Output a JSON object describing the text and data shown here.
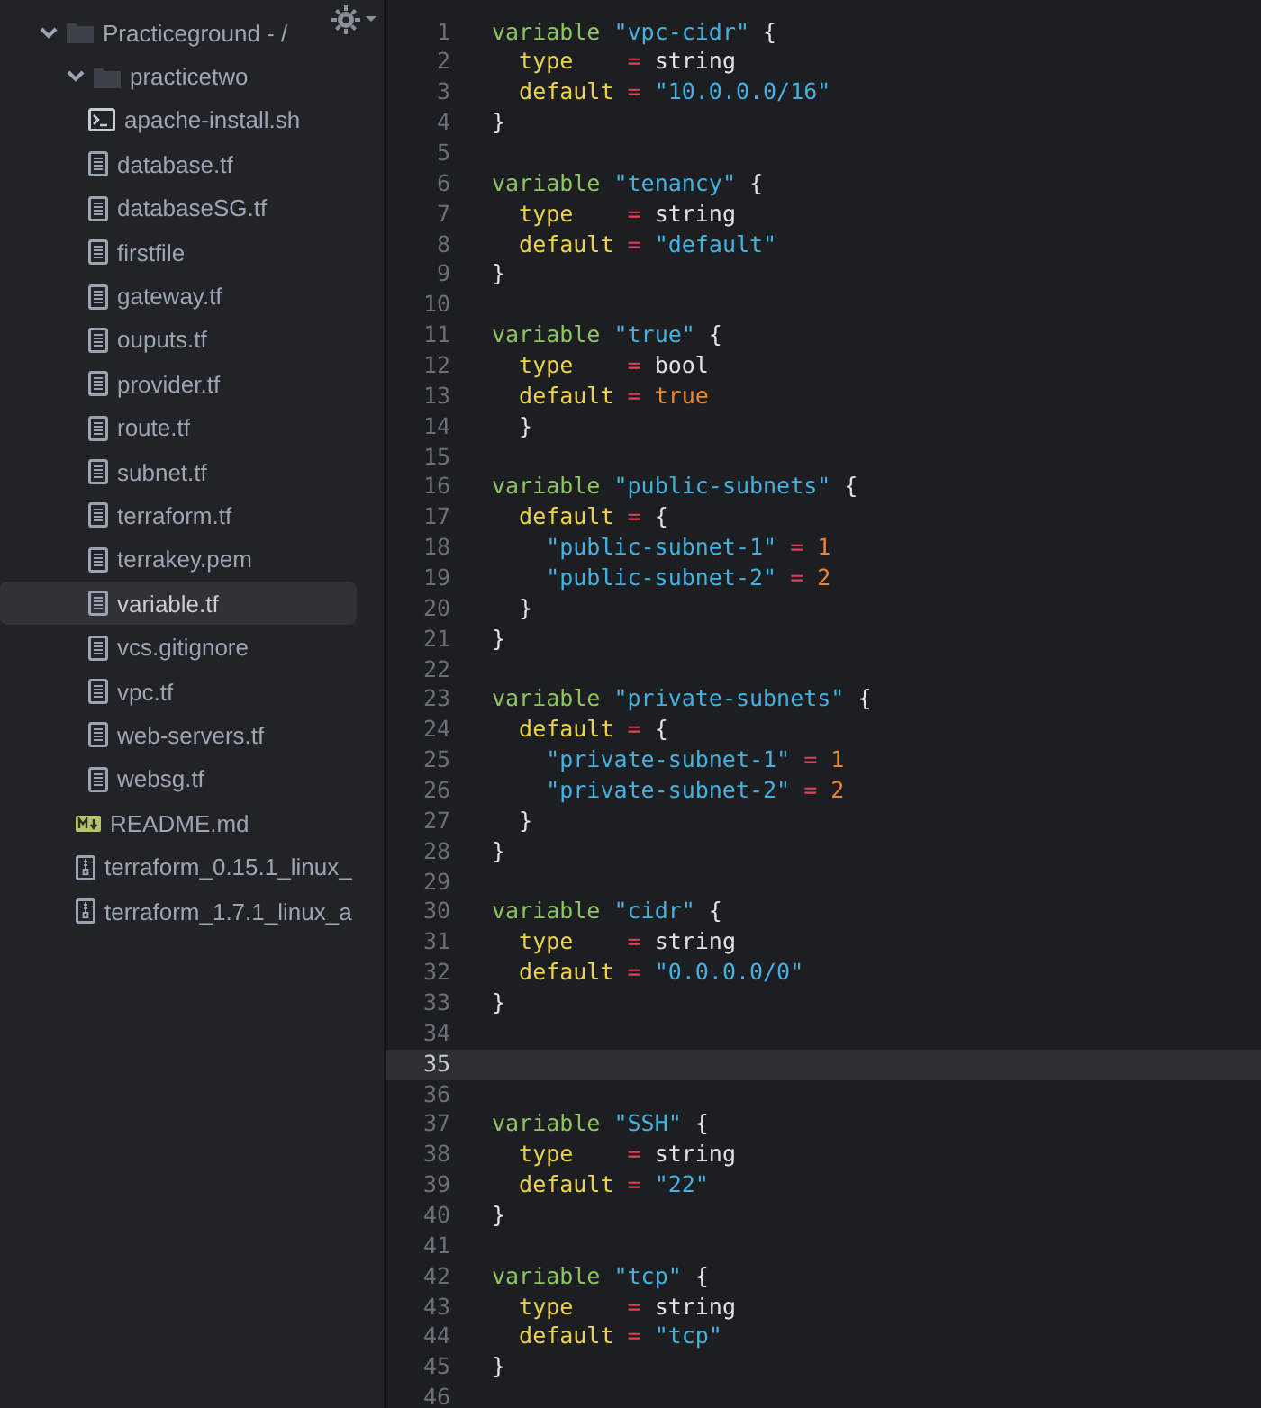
{
  "sidebar": {
    "tree": [
      {
        "label": "Practiceground - /",
        "kind": "folder",
        "expanded": true,
        "selected": false,
        "children": [
          {
            "label": "practicetwo",
            "kind": "folder",
            "expanded": true,
            "selected": false,
            "children": [
              {
                "label": "apache-install.sh",
                "kind": "terminal",
                "selected": false
              },
              {
                "label": "database.tf",
                "kind": "file",
                "selected": false
              },
              {
                "label": "databaseSG.tf",
                "kind": "file",
                "selected": false
              },
              {
                "label": "firstfile",
                "kind": "file",
                "selected": false
              },
              {
                "label": "gateway.tf",
                "kind": "file",
                "selected": false
              },
              {
                "label": "ouputs.tf",
                "kind": "file",
                "selected": false
              },
              {
                "label": "provider.tf",
                "kind": "file",
                "selected": false
              },
              {
                "label": "route.tf",
                "kind": "file",
                "selected": false
              },
              {
                "label": "subnet.tf",
                "kind": "file",
                "selected": false
              },
              {
                "label": "terraform.tf",
                "kind": "file",
                "selected": false
              },
              {
                "label": "terrakey.pem",
                "kind": "file",
                "selected": false
              },
              {
                "label": "variable.tf",
                "kind": "file",
                "selected": true
              },
              {
                "label": "vcs.gitignore",
                "kind": "file",
                "selected": false
              },
              {
                "label": "vpc.tf",
                "kind": "file",
                "selected": false
              },
              {
                "label": "web-servers.tf",
                "kind": "file",
                "selected": false
              },
              {
                "label": "websg.tf",
                "kind": "file",
                "selected": false
              }
            ]
          },
          {
            "label": "README.md",
            "kind": "markdown",
            "selected": false
          },
          {
            "label": "terraform_0.15.1_linux_",
            "kind": "archive",
            "selected": false
          },
          {
            "label": "terraform_1.7.1_linux_a",
            "kind": "archive",
            "selected": false
          }
        ]
      }
    ]
  },
  "editor": {
    "lines": [
      {
        "number": "1",
        "current": false,
        "tokens": [
          {
            "kind": "keyword",
            "text": "variable"
          },
          {
            "kind": "string",
            "text": " \"vpc-cidr\""
          },
          {
            "kind": "plain",
            "text": " {"
          }
        ]
      },
      {
        "number": "2",
        "current": false,
        "tokens": [
          {
            "kind": "property",
            "text": "  type"
          },
          {
            "kind": "operator",
            "text": "    ="
          },
          {
            "kind": "plain",
            "text": " string"
          }
        ]
      },
      {
        "number": "3",
        "current": false,
        "tokens": [
          {
            "kind": "property",
            "text": "  default"
          },
          {
            "kind": "operator",
            "text": " ="
          },
          {
            "kind": "string",
            "text": " \"10.0.0.0/16\""
          }
        ]
      },
      {
        "number": "4",
        "current": false,
        "tokens": [
          {
            "kind": "plain",
            "text": "}"
          }
        ]
      },
      {
        "number": "5",
        "current": false
      },
      {
        "number": "6",
        "current": false,
        "tokens": [
          {
            "kind": "keyword",
            "text": "variable"
          },
          {
            "kind": "string",
            "text": " \"tenancy\""
          },
          {
            "kind": "plain",
            "text": " {"
          }
        ]
      },
      {
        "number": "7",
        "current": false,
        "tokens": [
          {
            "kind": "property",
            "text": "  type"
          },
          {
            "kind": "operator",
            "text": "    ="
          },
          {
            "kind": "plain",
            "text": " string"
          }
        ]
      },
      {
        "number": "8",
        "current": false,
        "tokens": [
          {
            "kind": "property",
            "text": "  default"
          },
          {
            "kind": "operator",
            "text": " ="
          },
          {
            "kind": "string",
            "text": " \"default\""
          }
        ]
      },
      {
        "number": "9",
        "current": false,
        "tokens": [
          {
            "kind": "plain",
            "text": "}"
          }
        ]
      },
      {
        "number": "10",
        "current": false
      },
      {
        "number": "11",
        "current": false,
        "tokens": [
          {
            "kind": "keyword",
            "text": "variable"
          },
          {
            "kind": "string",
            "text": " \"true\""
          },
          {
            "kind": "plain",
            "text": " {"
          }
        ]
      },
      {
        "number": "12",
        "current": false,
        "tokens": [
          {
            "kind": "property",
            "text": "  type"
          },
          {
            "kind": "operator",
            "text": "    ="
          },
          {
            "kind": "plain",
            "text": " bool"
          }
        ]
      },
      {
        "number": "13",
        "current": false,
        "tokens": [
          {
            "kind": "property",
            "text": "  default"
          },
          {
            "kind": "operator",
            "text": " ="
          },
          {
            "kind": "number",
            "text": " true"
          }
        ]
      },
      {
        "number": "14",
        "current": false,
        "tokens": [
          {
            "kind": "plain",
            "text": "  }"
          }
        ]
      },
      {
        "number": "15",
        "current": false
      },
      {
        "number": "16",
        "current": false,
        "tokens": [
          {
            "kind": "keyword",
            "text": "variable"
          },
          {
            "kind": "string",
            "text": " \"public-subnets\""
          },
          {
            "kind": "plain",
            "text": " {"
          }
        ]
      },
      {
        "number": "17",
        "current": false,
        "tokens": [
          {
            "kind": "property",
            "text": "  default"
          },
          {
            "kind": "operator",
            "text": " ="
          },
          {
            "kind": "plain",
            "text": " {"
          }
        ]
      },
      {
        "number": "18",
        "current": false,
        "tokens": [
          {
            "kind": "string",
            "text": "    \"public-subnet-1\""
          },
          {
            "kind": "operator",
            "text": " ="
          },
          {
            "kind": "number",
            "text": " 1"
          }
        ]
      },
      {
        "number": "19",
        "current": false,
        "tokens": [
          {
            "kind": "string",
            "text": "    \"public-subnet-2\""
          },
          {
            "kind": "operator",
            "text": " ="
          },
          {
            "kind": "number",
            "text": " 2"
          }
        ]
      },
      {
        "number": "20",
        "current": false,
        "tokens": [
          {
            "kind": "plain",
            "text": "  }"
          }
        ]
      },
      {
        "number": "21",
        "current": false,
        "tokens": [
          {
            "kind": "plain",
            "text": "}"
          }
        ]
      },
      {
        "number": "22",
        "current": false
      },
      {
        "number": "23",
        "current": false,
        "tokens": [
          {
            "kind": "keyword",
            "text": "variable"
          },
          {
            "kind": "string",
            "text": " \"private-subnets\""
          },
          {
            "kind": "plain",
            "text": " {"
          }
        ]
      },
      {
        "number": "24",
        "current": false,
        "tokens": [
          {
            "kind": "property",
            "text": "  default"
          },
          {
            "kind": "operator",
            "text": " ="
          },
          {
            "kind": "plain",
            "text": " {"
          }
        ]
      },
      {
        "number": "25",
        "current": false,
        "tokens": [
          {
            "kind": "string",
            "text": "    \"private-subnet-1\""
          },
          {
            "kind": "operator",
            "text": " ="
          },
          {
            "kind": "number",
            "text": " 1"
          }
        ]
      },
      {
        "number": "26",
        "current": false,
        "tokens": [
          {
            "kind": "string",
            "text": "    \"private-subnet-2\""
          },
          {
            "kind": "operator",
            "text": " ="
          },
          {
            "kind": "number",
            "text": " 2"
          }
        ]
      },
      {
        "number": "27",
        "current": false,
        "tokens": [
          {
            "kind": "plain",
            "text": "  }"
          }
        ]
      },
      {
        "number": "28",
        "current": false,
        "tokens": [
          {
            "kind": "plain",
            "text": "}"
          }
        ]
      },
      {
        "number": "29",
        "current": false
      },
      {
        "number": "30",
        "current": false,
        "tokens": [
          {
            "kind": "keyword",
            "text": "variable"
          },
          {
            "kind": "string",
            "text": " \"cidr\""
          },
          {
            "kind": "plain",
            "text": " {"
          }
        ]
      },
      {
        "number": "31",
        "current": false,
        "tokens": [
          {
            "kind": "property",
            "text": "  type"
          },
          {
            "kind": "operator",
            "text": "    ="
          },
          {
            "kind": "plain",
            "text": " string"
          }
        ]
      },
      {
        "number": "32",
        "current": false,
        "tokens": [
          {
            "kind": "property",
            "text": "  default"
          },
          {
            "kind": "operator",
            "text": " ="
          },
          {
            "kind": "string",
            "text": " \"0.0.0.0/0\""
          }
        ]
      },
      {
        "number": "33",
        "current": false,
        "tokens": [
          {
            "kind": "plain",
            "text": "}"
          }
        ]
      },
      {
        "number": "34",
        "current": false
      },
      {
        "number": "35",
        "current": true
      },
      {
        "number": "36",
        "current": false
      },
      {
        "number": "37",
        "current": false,
        "tokens": [
          {
            "kind": "keyword",
            "text": "variable"
          },
          {
            "kind": "string",
            "text": " \"SSH\""
          },
          {
            "kind": "plain",
            "text": " {"
          }
        ]
      },
      {
        "number": "38",
        "current": false,
        "tokens": [
          {
            "kind": "property",
            "text": "  type"
          },
          {
            "kind": "operator",
            "text": "    ="
          },
          {
            "kind": "plain",
            "text": " string"
          }
        ]
      },
      {
        "number": "39",
        "current": false,
        "tokens": [
          {
            "kind": "property",
            "text": "  default"
          },
          {
            "kind": "operator",
            "text": " ="
          },
          {
            "kind": "string",
            "text": " \"22\""
          }
        ]
      },
      {
        "number": "40",
        "current": false,
        "tokens": [
          {
            "kind": "plain",
            "text": "}"
          }
        ]
      },
      {
        "number": "41",
        "current": false
      },
      {
        "number": "42",
        "current": false,
        "tokens": [
          {
            "kind": "keyword",
            "text": "variable"
          },
          {
            "kind": "string",
            "text": " \"tcp\""
          },
          {
            "kind": "plain",
            "text": " {"
          }
        ]
      },
      {
        "number": "43",
        "current": false,
        "tokens": [
          {
            "kind": "property",
            "text": "  type"
          },
          {
            "kind": "operator",
            "text": "    ="
          },
          {
            "kind": "plain",
            "text": " string"
          }
        ]
      },
      {
        "number": "44",
        "current": false,
        "tokens": [
          {
            "kind": "property",
            "text": "  default"
          },
          {
            "kind": "operator",
            "text": " ="
          },
          {
            "kind": "string",
            "text": " \"tcp\""
          }
        ]
      },
      {
        "number": "45",
        "current": false,
        "tokens": [
          {
            "kind": "plain",
            "text": "}"
          }
        ]
      },
      {
        "number": "46",
        "current": false
      }
    ]
  }
}
